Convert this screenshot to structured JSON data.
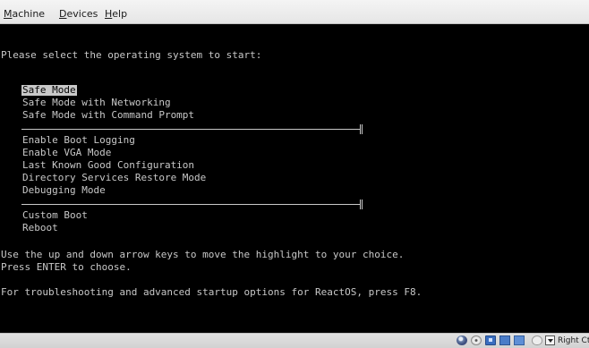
{
  "menubar": {
    "items": [
      {
        "label": "Machine",
        "mnemonic": "M",
        "rest": "achine"
      },
      {
        "label": "Devices",
        "mnemonic": "D",
        "rest": "evices"
      },
      {
        "label": "Help",
        "mnemonic": "H",
        "rest": "elp"
      }
    ]
  },
  "console": {
    "prompt": "Please select the operating system to start:",
    "options_group_1": [
      "Safe Mode",
      "Safe Mode with Networking",
      "Safe Mode with Command Prompt"
    ],
    "options_group_2": [
      "Enable Boot Logging",
      "Enable VGA Mode",
      "Last Known Good Configuration",
      "Directory Services Restore Mode",
      "Debugging Mode"
    ],
    "options_group_3": [
      "Custom Boot",
      "Reboot"
    ],
    "selected_option": "Safe Mode",
    "help_lines": [
      "Use the up and down arrow keys to move the highlight to your choice.",
      "Press ENTER to choose."
    ],
    "troubleshooting": "For troubleshooting and advanced startup options for ReactOS, press F8."
  },
  "statusbar": {
    "host_key": "Right Ctrl",
    "icons": [
      "hard-disk-icon",
      "optical-drive-icon",
      "network-icon",
      "usb-icon",
      "shared-folders-icon",
      "mouse-integration-icon",
      "keyboard-capture-icon"
    ]
  },
  "colors": {
    "console_background": "#000000",
    "console_text": "#c8c8c8",
    "highlight_background": "#c8c8c8",
    "highlight_text": "#000000"
  }
}
